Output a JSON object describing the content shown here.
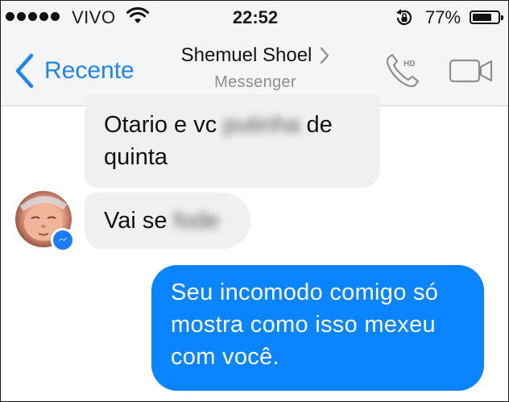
{
  "status_bar": {
    "carrier": "VIVO",
    "time": "22:52",
    "battery_percent": "77%",
    "battery_level": 0.77,
    "icons": [
      "signal-dots-icon",
      "wifi-icon",
      "rotation-lock-icon",
      "battery-icon"
    ]
  },
  "nav": {
    "back_label": "Recente",
    "contact_name": "Shemuel Shoel",
    "subtitle": "Messenger",
    "call_badge": "HD",
    "icons": [
      "back-chevron-icon",
      "chevron-right-icon",
      "phone-hd-icon",
      "video-camera-icon"
    ]
  },
  "messages": [
    {
      "direction": "incoming",
      "before": "Otario e vc ",
      "blurred": "putinha",
      "after_line1": " de",
      "line2": "quinta"
    },
    {
      "direction": "incoming",
      "before": "Vai se ",
      "blurred": "fode"
    },
    {
      "direction": "outgoing",
      "text": "Seu incomodo comigo só mostra como isso mexeu com você."
    }
  ],
  "colors": {
    "accent": "#1f84ef",
    "outgoing_bubble": "#0a84ff",
    "incoming_bubble": "#f1f0f0",
    "header_bg": "#f4f5f7"
  }
}
